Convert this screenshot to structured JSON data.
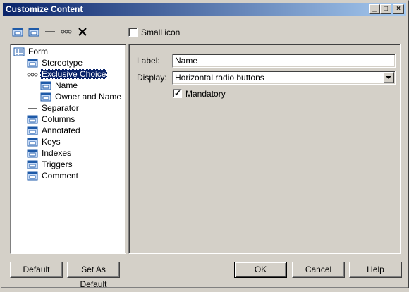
{
  "window": {
    "title": "Customize Content",
    "minimize_icon": "_",
    "maximize_icon": "□",
    "close_icon": "×"
  },
  "toolbar": {
    "small_icon_label": "Small icon",
    "small_icon_checked": false
  },
  "tree": {
    "items": [
      {
        "label": "Form",
        "icon": "form-icon"
      },
      {
        "label": "Stereotype",
        "icon": "attribute-icon"
      },
      {
        "label": "Exclusive Choice",
        "icon": "exclusive-choice-icon"
      },
      {
        "label": "Name",
        "icon": "attribute-icon"
      },
      {
        "label": "Owner and Name",
        "icon": "attribute-icon"
      },
      {
        "label": "Separator",
        "icon": "separator-icon"
      },
      {
        "label": "Columns",
        "icon": "attribute-icon"
      },
      {
        "label": "Annotated",
        "icon": "attribute-icon"
      },
      {
        "label": "Keys",
        "icon": "attribute-icon"
      },
      {
        "label": "Indexes",
        "icon": "attribute-icon"
      },
      {
        "label": "Triggers",
        "icon": "attribute-icon"
      },
      {
        "label": "Comment",
        "icon": "attribute-icon"
      }
    ],
    "selected": "Exclusive Choice"
  },
  "properties": {
    "label_caption": "Label:",
    "label_value": "Name",
    "display_caption": "Display:",
    "display_value": "Horizontal radio buttons",
    "mandatory_label": "Mandatory",
    "mandatory_checked": true
  },
  "buttons": {
    "default": "Default",
    "set_as_default": "Set As Default",
    "ok": "OK",
    "cancel": "Cancel",
    "help": "Help"
  }
}
